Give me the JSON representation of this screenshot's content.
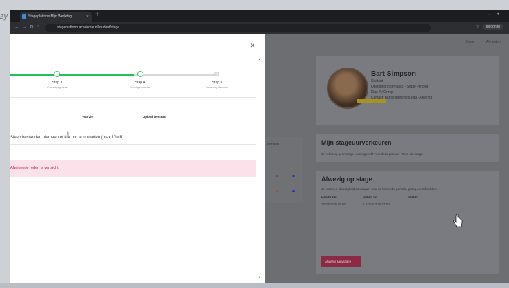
{
  "desktop": {
    "text": "zy"
  },
  "browser": {
    "tab_title": "Stageplatform Mijn Werkdag",
    "url": "stageplatform.academie.nl/student/stage",
    "right_button": "Incognito"
  },
  "modal": {
    "steps": [
      {
        "label": "Stap 3",
        "sub": "Contactgegevens"
      },
      {
        "label": "Stap 4",
        "sub": "Ervaringsformulier"
      },
      {
        "label": "Stap 5",
        "sub": "Indiening afronden"
      }
    ],
    "tabs": [
      "Voorzie",
      "Upload bestand"
    ],
    "upload_hint": "Sleep bestanden hierheen of klik om te uploaden (max 10MB)",
    "alert": "Afwijkende reden is verplicht"
  },
  "profile": {
    "name": "Bart Simpson",
    "lines": [
      "Student",
      "Opleiding Informatica - Stage Periode",
      "Klas 4 / Groep",
      "Contact: bart@springfield.edu - Afwezig"
    ]
  },
  "top_links": [
    "Stage",
    "Afmelden"
  ],
  "card_hours": {
    "title": "Mijn stageuurverkeuren",
    "text": "Je hebt nog geen stage uren ingevuld voor deze periode - Toon alle stage"
  },
  "card_absence": {
    "title": "Afwezig op stage",
    "text": "Je kunt een afwezigheid aanvragen voor de komende periode, graag vooraf melden.",
    "columns": [
      "Datum van",
      "Datum tot",
      "Status"
    ],
    "row": [
      "27/04/2025 09:00",
      "1  27/04/2025 17:00",
      ""
    ],
    "button": "Afwezig aanvragen"
  },
  "left_card": {
    "header": "Overzicht"
  },
  "colors": {
    "green": "#23c05a",
    "alert_bg": "#fbe1ea",
    "alert_text": "#b4254c",
    "pink_button": "#8a2a45",
    "status_badge": "#a89320"
  }
}
